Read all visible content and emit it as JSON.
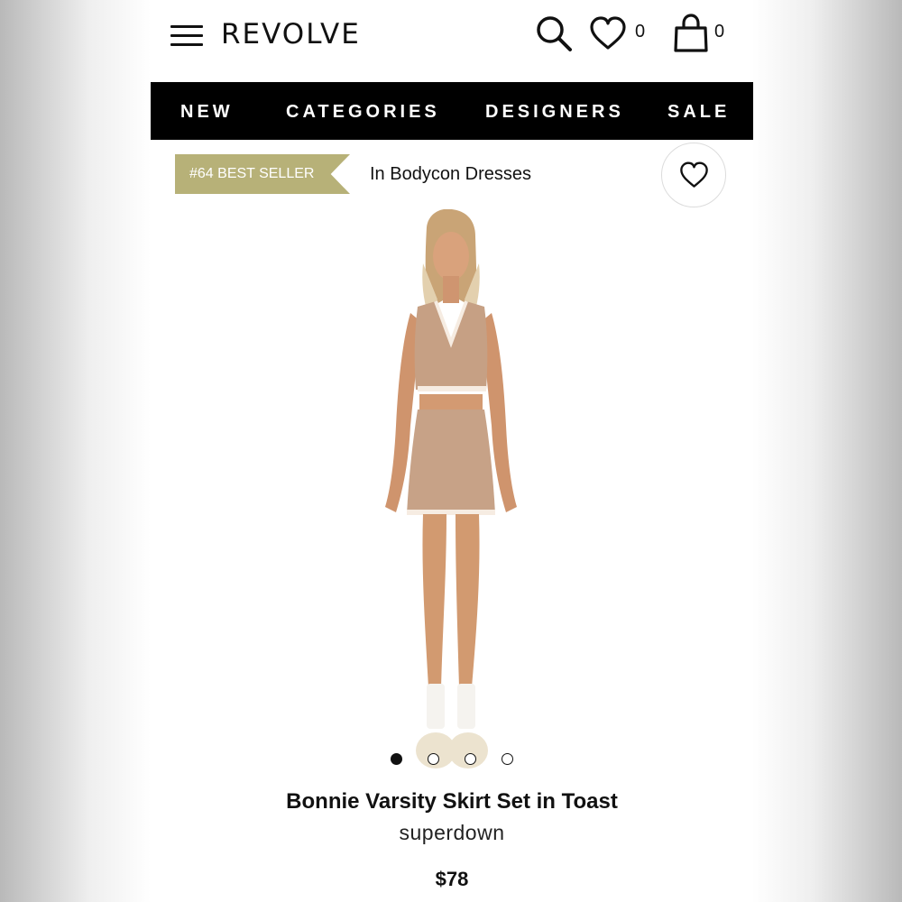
{
  "header": {
    "menu_icon": "hamburger-menu-icon",
    "logo": "REVOLVE",
    "search_icon": "search-icon",
    "wishlist_icon": "heart-icon",
    "wishlist_count": "0",
    "bag_icon": "shopping-bag-icon",
    "bag_count": "0"
  },
  "nav": {
    "items": [
      "NEW",
      "CATEGORIES",
      "DESIGNERS",
      "SALE"
    ]
  },
  "product": {
    "best_seller_badge": "#64 BEST SELLER",
    "category": "In Bodycon Dresses",
    "favorite_icon": "heart-icon",
    "image_icon": "model-product-photo",
    "carousel": {
      "total": 4,
      "active": 1
    },
    "title": "Bonnie Varsity Skirt Set in Toast",
    "brand": "superdown",
    "price": "$78"
  },
  "colors": {
    "nav_background": "#000000",
    "badge_background": "#b7b178",
    "text": "#111111"
  }
}
